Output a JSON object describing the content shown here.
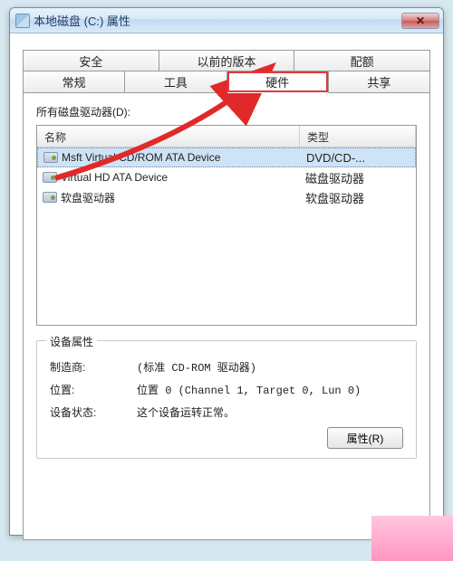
{
  "window": {
    "title": "本地磁盘 (C:) 属性",
    "close_glyph": "✕"
  },
  "tabs": {
    "row1": [
      "安全",
      "以前的版本",
      "配额"
    ],
    "row2": [
      "常规",
      "工具",
      "硬件",
      "共享"
    ],
    "active": "硬件"
  },
  "hardware": {
    "list_label": "所有磁盘驱动器(D):",
    "columns": {
      "name": "名称",
      "type": "类型"
    },
    "rows": [
      {
        "name": "Msft Virtual CD/ROM ATA Device",
        "type": "DVD/CD-...",
        "selected": true
      },
      {
        "name": "Virtual HD ATA Device",
        "type": "磁盘驱动器",
        "selected": false
      },
      {
        "name": "软盘驱动器",
        "type": "软盘驱动器",
        "selected": false
      }
    ],
    "group": {
      "legend": "设备属性",
      "manufacturer_label": "制造商:",
      "manufacturer_value": "(标准 CD-ROM 驱动器)",
      "location_label": "位置:",
      "location_value": "位置 0 (Channel 1, Target 0, Lun 0)",
      "status_label": "设备状态:",
      "status_value": "这个设备运转正常。",
      "properties_button": "属性(R)"
    }
  }
}
